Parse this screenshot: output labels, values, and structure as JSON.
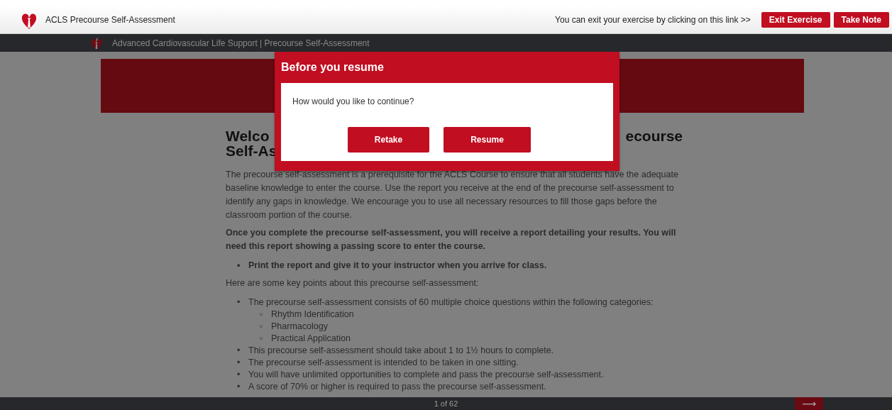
{
  "header": {
    "title": "ACLS Precourse Self-Assessment",
    "exit_hint": "You can exit your exercise by clicking on this link >>",
    "buttons": [
      "Exit Exercise",
      "Take Note"
    ]
  },
  "nav": {
    "title": "Advanced Cardiovascular Life Support | Precourse Self-Assessment"
  },
  "content": {
    "heading_fragments": [
      "Welco",
      "ecourse",
      "Self-As"
    ],
    "intro": "The precourse self-assessment is a prerequisite for the ACLS Course to ensure that all students have the adequate baseline knowledge to enter the course. Use the report you receive at the end of the precourse self-assessment to identify any gaps in knowledge. We encourage you to use all necessary resources to fill those gaps before the classroom portion of the course.",
    "notice": "Once you complete the precourse self-assessment, you will receive a report detailing your results. You will need this report showing a passing score to enter the course.",
    "notice_bullets": [
      {
        "marker": "•",
        "text": "Print the report and give it to your instructor when you arrive for class."
      }
    ],
    "key_points_intro": "Here are some key points about this precourse self-assessment:",
    "key_points": [
      {
        "marker": "•",
        "text": "The precourse self-assessment consists of 60 multiple choice questions within the following categories:",
        "children": [
          {
            "marker": "◦",
            "text": "Rhythm Identification"
          },
          {
            "marker": "◦",
            "text": "Pharmacology"
          },
          {
            "marker": "◦",
            "text": "Practical Application"
          }
        ]
      },
      {
        "marker": "•",
        "text": "This precourse self-assessment should take about 1 to 1½ hours to complete."
      },
      {
        "marker": "•",
        "text": "The precourse self-assessment is intended to be taken in one sitting."
      },
      {
        "marker": "•",
        "text": "You will have unlimited opportunities to complete and pass the precourse self-assessment."
      },
      {
        "marker": "•",
        "text": "A score of 70% or higher is required to pass the precourse self-assessment."
      }
    ]
  },
  "footer": {
    "page": "1 of 62",
    "next": "⟶"
  },
  "dialog": {
    "title": "Before you resume",
    "message": "How would you like to continue?",
    "buttons": [
      "Retake",
      "Resume"
    ]
  }
}
